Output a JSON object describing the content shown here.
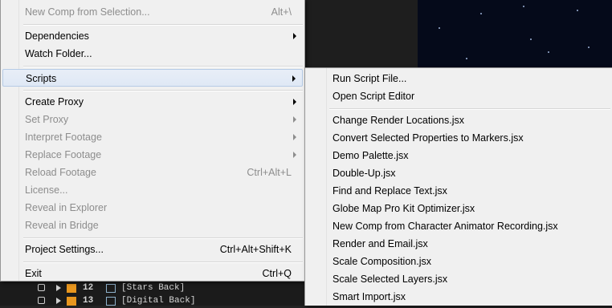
{
  "main_menu": {
    "items": [
      {
        "label": "New Comp from Selection...",
        "shortcut": "Alt+\\",
        "disabled": true
      },
      {
        "label": "Dependencies",
        "submenu": true
      },
      {
        "label": "Watch Folder..."
      },
      {
        "label": "Scripts",
        "submenu": true,
        "highlighted": true
      },
      {
        "label": "Create Proxy",
        "submenu": true
      },
      {
        "label": "Set Proxy",
        "submenu": true,
        "disabled": true
      },
      {
        "label": "Interpret Footage",
        "submenu": true,
        "disabled": true
      },
      {
        "label": "Replace Footage",
        "submenu": true,
        "disabled": true
      },
      {
        "label": "Reload Footage",
        "shortcut": "Ctrl+Alt+L",
        "disabled": true
      },
      {
        "label": "License...",
        "disabled": true
      },
      {
        "label": "Reveal in Explorer",
        "disabled": true
      },
      {
        "label": "Reveal in Bridge",
        "disabled": true
      },
      {
        "label": "Project Settings...",
        "shortcut": "Ctrl+Alt+Shift+K"
      },
      {
        "label": "Exit",
        "shortcut": "Ctrl+Q"
      }
    ]
  },
  "scripts_submenu": {
    "items": [
      {
        "label": "Run Script File..."
      },
      {
        "label": "Open Script Editor"
      },
      {
        "label": "Change Render Locations.jsx"
      },
      {
        "label": "Convert Selected Properties to Markers.jsx"
      },
      {
        "label": "Demo Palette.jsx"
      },
      {
        "label": "Double-Up.jsx"
      },
      {
        "label": "Find and Replace Text.jsx"
      },
      {
        "label": "Globe Map Pro Kit Optimizer.jsx"
      },
      {
        "label": "New Comp from Character Animator Recording.jsx"
      },
      {
        "label": "Render and Email.jsx"
      },
      {
        "label": "Scale Composition.jsx"
      },
      {
        "label": "Scale Selected Layers.jsx"
      },
      {
        "label": "Smart Import.jsx"
      }
    ]
  },
  "timeline_layers": [
    {
      "number": "12",
      "name": "[Stars Back]"
    },
    {
      "number": "13",
      "name": "[Digital Back]"
    }
  ],
  "colors": {
    "menu_bg": "#f0f0f0",
    "highlight": "#dfe8f5",
    "disabled_text": "#8d8d8d",
    "label_swatch": "#e8961e",
    "comp_bg": "#050a1a"
  }
}
